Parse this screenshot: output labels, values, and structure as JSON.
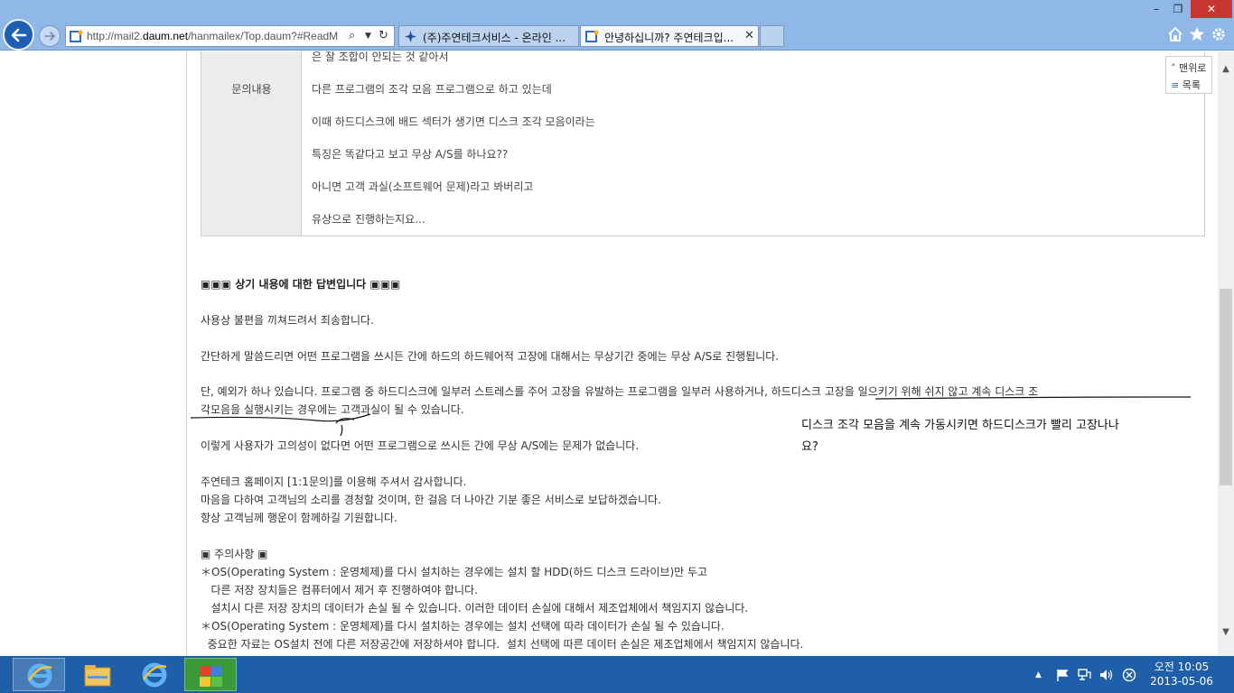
{
  "browser": {
    "address": {
      "url_prefix": "http://mail2.",
      "url_domain": "daum.net",
      "url_suffix": "/hanmailex/Top.daum?#ReadM"
    },
    "tabs": [
      {
        "label": "(주)주연테크서비스 - 온라인 ..."
      },
      {
        "label": "안녕하십니까? 주연테크입..."
      }
    ],
    "window_controls": {
      "minimize": "–",
      "maximize": "❐",
      "close": "✕"
    },
    "colors": {
      "chrome": "#8fb8e8",
      "back_button": "#1e5fb3",
      "close_button": "#c7372f",
      "taskbar": "#1f5ea8"
    }
  },
  "question": {
    "header": "문의내용",
    "lines": [
      "은 잘 조합이 안되는 것 같아서",
      "다른 프로그램의 조각 모음 프로그램으로 하고 있는데",
      "이때 하드디스크에 배드 섹터가 생기면 디스크 조각 모음이라는",
      "특징은 똑같다고 보고 무상 A/S를 하나요??",
      "아니면 고객 과실(소프트웨어 문제)라고 봐버리고",
      "유상으로 진행하는지요..."
    ]
  },
  "answer": {
    "heading": "▣▣▣ 상기 내용에 대한 답변입니다 ▣▣▣",
    "apology": "사용상 불편을 끼쳐드려서 죄송합니다.",
    "summary": "간단하게 말씀드리면 어떤 프로그램을 쓰시든 간에 하드의 하드웨어적 고장에 대해서는 무상기간 중에는 무상 A/S로 진행됩니다.",
    "exception_1": "단, 예외가 하나 있습니다. 프로그램 중 하드디스크에 일부러 스트레스를 주어 고장을 유발하는 프로그램을 일부러 사용하거나, 하드디스크 고장을 일으키기 위해 쉬지 않고 계속 디스크 조",
    "exception_2": "각모음을 실행시키는 경우에는 고객과실이 될 수 있습니다.",
    "no_intent": "이렇게 사용자가 고의성이 없다면 어떤 프로그램으로 쓰시든 간에 무상 A/S에는 문제가 없습니다.",
    "thanks_1": "주연테크 홈페이지 [1:1문의]를 이용해 주셔서 감사합니다.",
    "thanks_2": "마음을 다하여 고객님의 소리를 경청할 것이며, 한 걸음 더 나아간 기분 좋은 서비스로 보답하겠습니다.",
    "thanks_3": "항상 고객님께 행운이 함께하길 기원합니다.",
    "notice_title": "▣ 주의사항 ▣",
    "notice_lines": [
      "＊OS(Operating System : 운영체제)를 다시 설치하는 경우에는 설치 할 HDD(하드 디스크 드라이브)만 두고",
      "   다른 저장 장치들은 컴퓨터에서 제거 후 진행하여야 합니다.",
      "   설치시 다른 저장 장치의 데이터가 손실 될 수 있습니다. 이러한 데이터 손실에 대해서 제조업체에서 책임지지 않습니다.",
      "＊OS(Operating System : 운영체제)를 다시 설치하는 경우에는 설치 선택에 따라 데이터가 손실 될 수 있습니다.",
      "  중요한 자료는 OS설치 전에 다른 저장공간에 저장하셔야 합니다.  설치 선택에 따른 데이터 손실은 제조업체에서 책임지지 않습니다."
    ]
  },
  "annotation": {
    "line_1": "디스크 조각 모음을 계속 가동시키면 하드디스크가 빨리 고장나나",
    "line_2": "요?"
  },
  "quick_nav": {
    "top": "맨위로",
    "list": "목록"
  },
  "taskbar": {
    "clock_time": "오전 10:05",
    "clock_date": "2013-05-06"
  }
}
